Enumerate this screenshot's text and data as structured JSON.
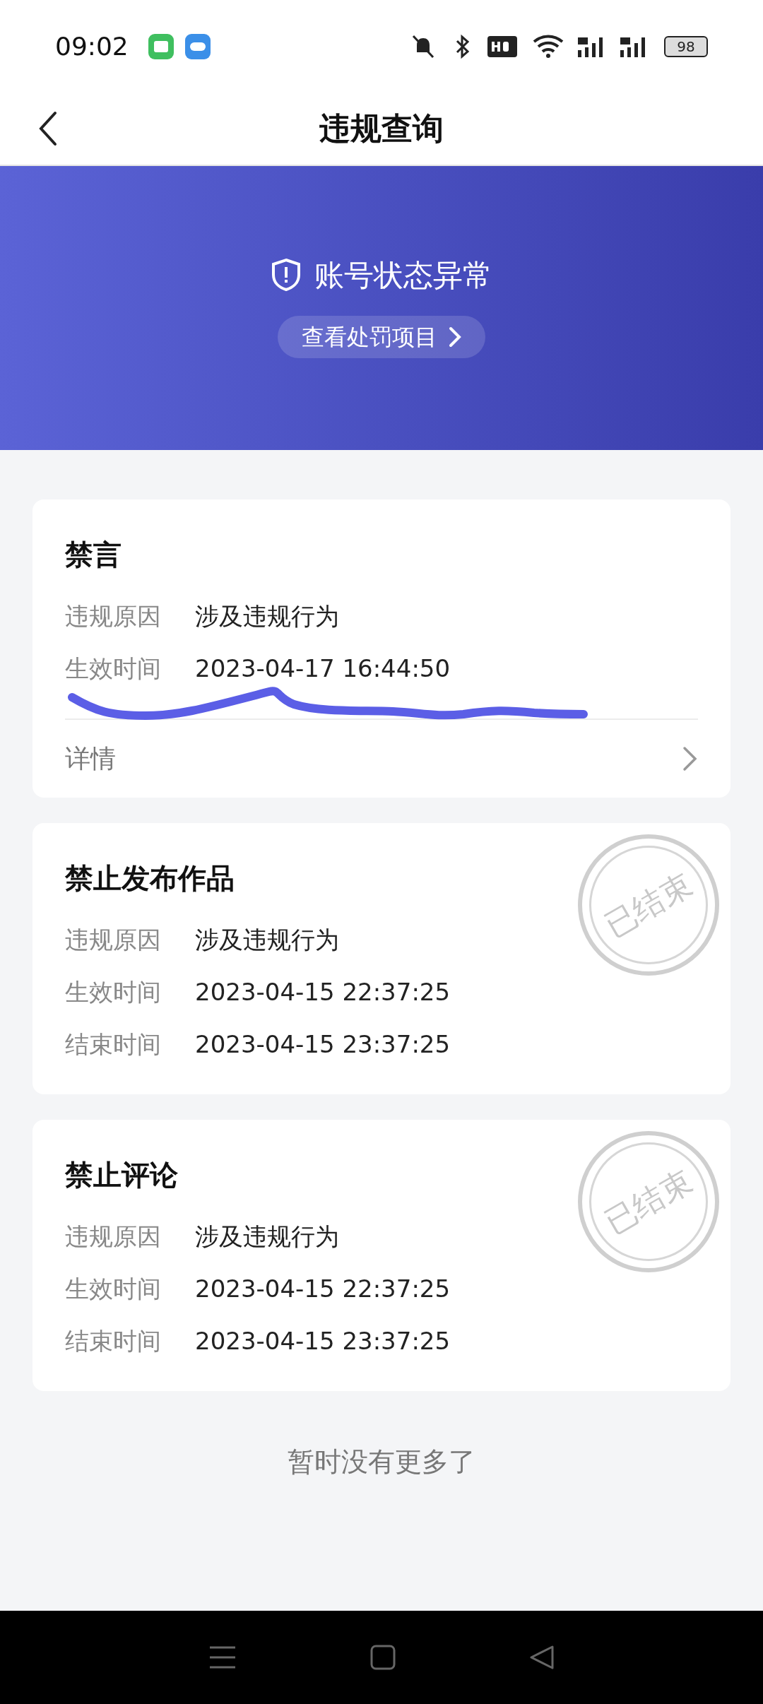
{
  "status_bar": {
    "time": "09:02",
    "battery": "98"
  },
  "header": {
    "title": "违规查询"
  },
  "banner": {
    "status": "账号状态异常",
    "link": "查看处罚项目"
  },
  "cards": [
    {
      "title": "禁言",
      "rows": [
        {
          "label": "违规原因",
          "value": "涉及违规行为"
        },
        {
          "label": "生效时间",
          "value": "2023-04-17 16:44:50"
        }
      ],
      "detail": "详情"
    },
    {
      "title": "禁止发布作品",
      "stamp": "已结束",
      "rows": [
        {
          "label": "违规原因",
          "value": "涉及违规行为"
        },
        {
          "label": "生效时间",
          "value": "2023-04-15 22:37:25"
        },
        {
          "label": "结束时间",
          "value": "2023-04-15 23:37:25"
        }
      ]
    },
    {
      "title": "禁止评论",
      "stamp": "已结束",
      "rows": [
        {
          "label": "违规原因",
          "value": "涉及违规行为"
        },
        {
          "label": "生效时间",
          "value": "2023-04-15 22:37:25"
        },
        {
          "label": "结束时间",
          "value": "2023-04-15 23:37:25"
        }
      ]
    }
  ],
  "footer": "暂时没有更多了"
}
